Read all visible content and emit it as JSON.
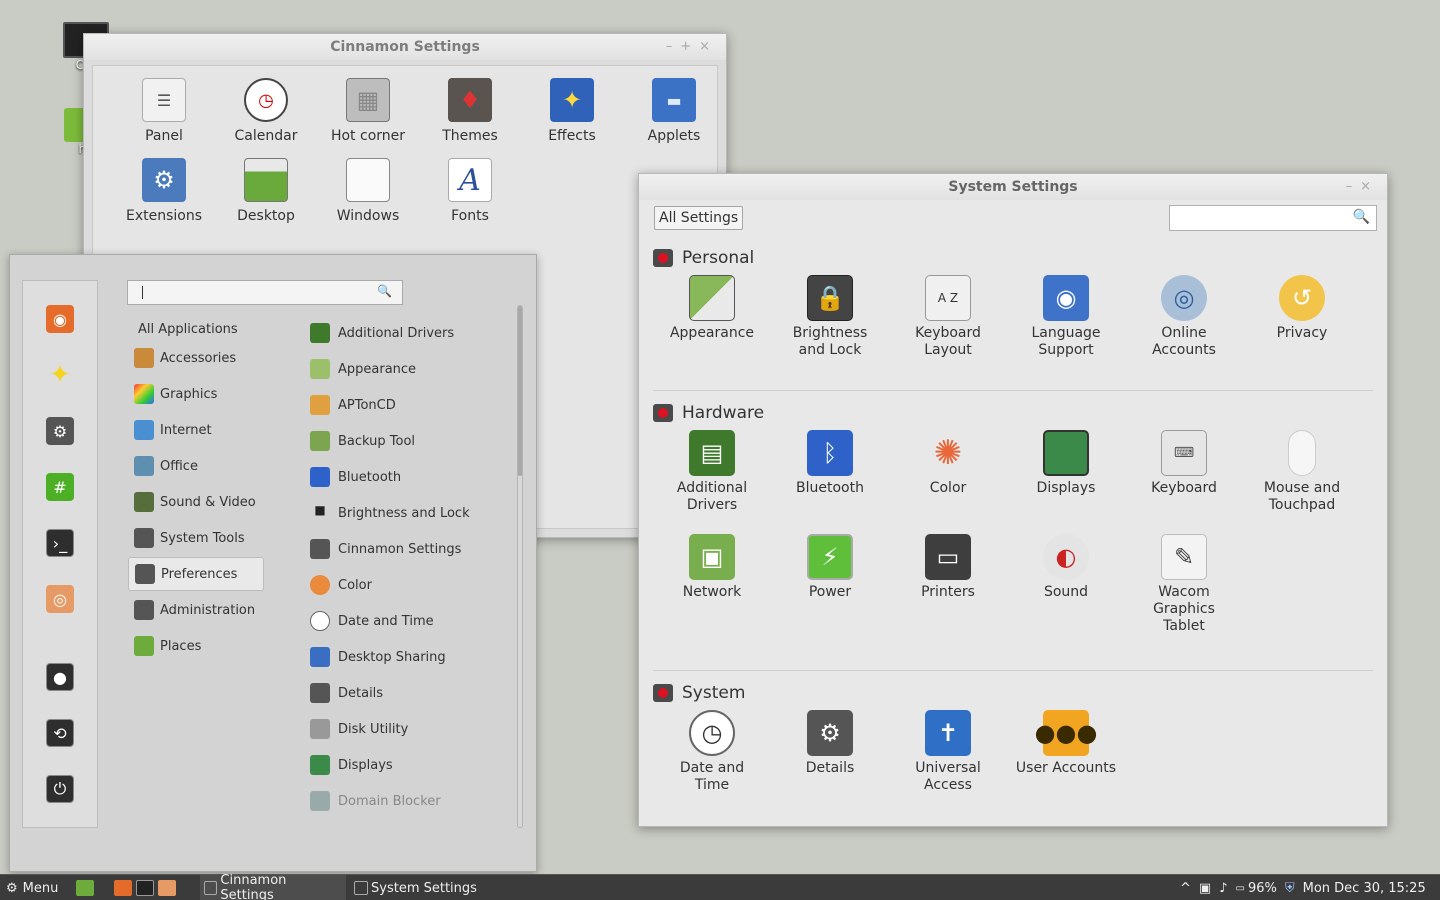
{
  "desktop": {
    "icons": [
      {
        "label": "Cor"
      },
      {
        "label": "ho"
      }
    ]
  },
  "cinnamon_settings": {
    "title": "Cinnamon Settings",
    "items": [
      {
        "label": "Panel",
        "icon": "panel-icon"
      },
      {
        "label": "Calendar",
        "icon": "calendar-icon"
      },
      {
        "label": "Hot corner",
        "icon": "hot-corner-icon"
      },
      {
        "label": "Themes",
        "icon": "themes-icon"
      },
      {
        "label": "Effects",
        "icon": "effects-icon"
      },
      {
        "label": "Applets",
        "icon": "applets-icon"
      },
      {
        "label": "Extensions",
        "icon": "extensions-icon"
      },
      {
        "label": "Desktop",
        "icon": "desktop-icon"
      },
      {
        "label": "Windows",
        "icon": "windows-icon"
      },
      {
        "label": "Fonts",
        "icon": "fonts-icon"
      }
    ]
  },
  "system_settings": {
    "title": "System Settings",
    "all_settings": "All Settings",
    "search_placeholder": "",
    "sections": [
      {
        "name": "Personal",
        "items": [
          {
            "label": "Appearance"
          },
          {
            "label": "Brightness\nand Lock"
          },
          {
            "label": "Keyboard\nLayout"
          },
          {
            "label": "Language\nSupport"
          },
          {
            "label": "Online\nAccounts"
          },
          {
            "label": "Privacy"
          }
        ]
      },
      {
        "name": "Hardware",
        "items": [
          {
            "label": "Additional\nDrivers"
          },
          {
            "label": "Bluetooth"
          },
          {
            "label": "Color"
          },
          {
            "label": "Displays"
          },
          {
            "label": "Keyboard"
          },
          {
            "label": "Mouse and\nTouchpad"
          },
          {
            "label": "Network"
          },
          {
            "label": "Power"
          },
          {
            "label": "Printers"
          },
          {
            "label": "Sound"
          },
          {
            "label": "Wacom\nGraphics\nTablet"
          }
        ]
      },
      {
        "name": "System",
        "items": [
          {
            "label": "Date and\nTime"
          },
          {
            "label": "Details"
          },
          {
            "label": "Universal\nAccess"
          },
          {
            "label": "User Accounts"
          }
        ]
      }
    ]
  },
  "menu": {
    "search_value": "",
    "categories": [
      {
        "label": "All Applications"
      },
      {
        "label": "Accessories"
      },
      {
        "label": "Graphics"
      },
      {
        "label": "Internet"
      },
      {
        "label": "Office"
      },
      {
        "label": "Sound & Video"
      },
      {
        "label": "System Tools"
      },
      {
        "label": "Preferences"
      },
      {
        "label": "Administration"
      },
      {
        "label": "Places"
      }
    ],
    "selected_category": "Preferences",
    "apps": [
      {
        "label": "Additional Drivers"
      },
      {
        "label": "Appearance"
      },
      {
        "label": "APTonCD"
      },
      {
        "label": "Backup Tool"
      },
      {
        "label": "Bluetooth"
      },
      {
        "label": "Brightness and Lock"
      },
      {
        "label": "Cinnamon Settings"
      },
      {
        "label": "Color"
      },
      {
        "label": "Date and Time"
      },
      {
        "label": "Desktop Sharing"
      },
      {
        "label": "Details"
      },
      {
        "label": "Disk Utility"
      },
      {
        "label": "Displays"
      },
      {
        "label": "Domain Blocker"
      }
    ]
  },
  "taskbar": {
    "menu_label": "Menu",
    "tasks": [
      {
        "label": "Cinnamon Settings"
      },
      {
        "label": "System Settings"
      }
    ],
    "battery": "96%",
    "clock": "Mon Dec 30, 15:25"
  }
}
